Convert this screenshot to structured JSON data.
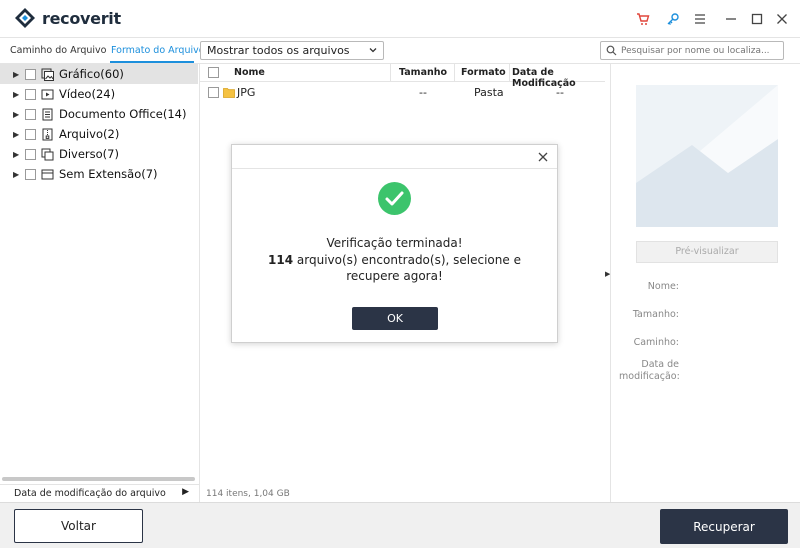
{
  "app": {
    "brand_main": "recover",
    "brand_suffix": "it"
  },
  "tabs": {
    "path_tab": "Caminho do Arquivo",
    "format_tab": "Formato do Arquivo"
  },
  "filter": {
    "selected": "Mostrar todos os arquivos"
  },
  "search": {
    "placeholder": "Pesquisar por nome ou localiza..."
  },
  "sidebar": {
    "items": [
      {
        "label": "Gráfico(60)",
        "icon": "image-icon",
        "selected": true
      },
      {
        "label": "Vídeo(24)",
        "icon": "video-icon"
      },
      {
        "label": "Documento Office(14)",
        "icon": "document-icon"
      },
      {
        "label": "Arquivo(2)",
        "icon": "archive-icon"
      },
      {
        "label": "Diverso(7)",
        "icon": "misc-icon"
      },
      {
        "label": "Sem Extensão(7)",
        "icon": "no-extension-icon"
      }
    ],
    "footer": "Data de modificação do arquivo"
  },
  "list": {
    "columns": {
      "name": "Nome",
      "size": "Tamanho",
      "format": "Formato",
      "modified": "Data de Modificação"
    },
    "rows": [
      {
        "name": "JPG",
        "size": "--",
        "format": "Pasta",
        "modified": "--"
      }
    ],
    "footer": "114 itens, 1,04  GB"
  },
  "preview": {
    "button": "Pré-visualizar",
    "labels": {
      "name": "Nome:",
      "size": "Tamanho:",
      "path": "Caminho:",
      "modified": "Data de modificação:"
    }
  },
  "bottom": {
    "back": "Voltar",
    "recover": "Recuperar"
  },
  "dialog": {
    "line1": "Verificação terminada!",
    "count": "114",
    "line2_rest": " arquivo(s) encontrado(s), selecione e recupere agora!",
    "ok": "OK"
  },
  "colors": {
    "accent": "#1c8fdc",
    "dark": "#2b3446",
    "success": "#3cc46c",
    "cart": "#e0463c"
  }
}
